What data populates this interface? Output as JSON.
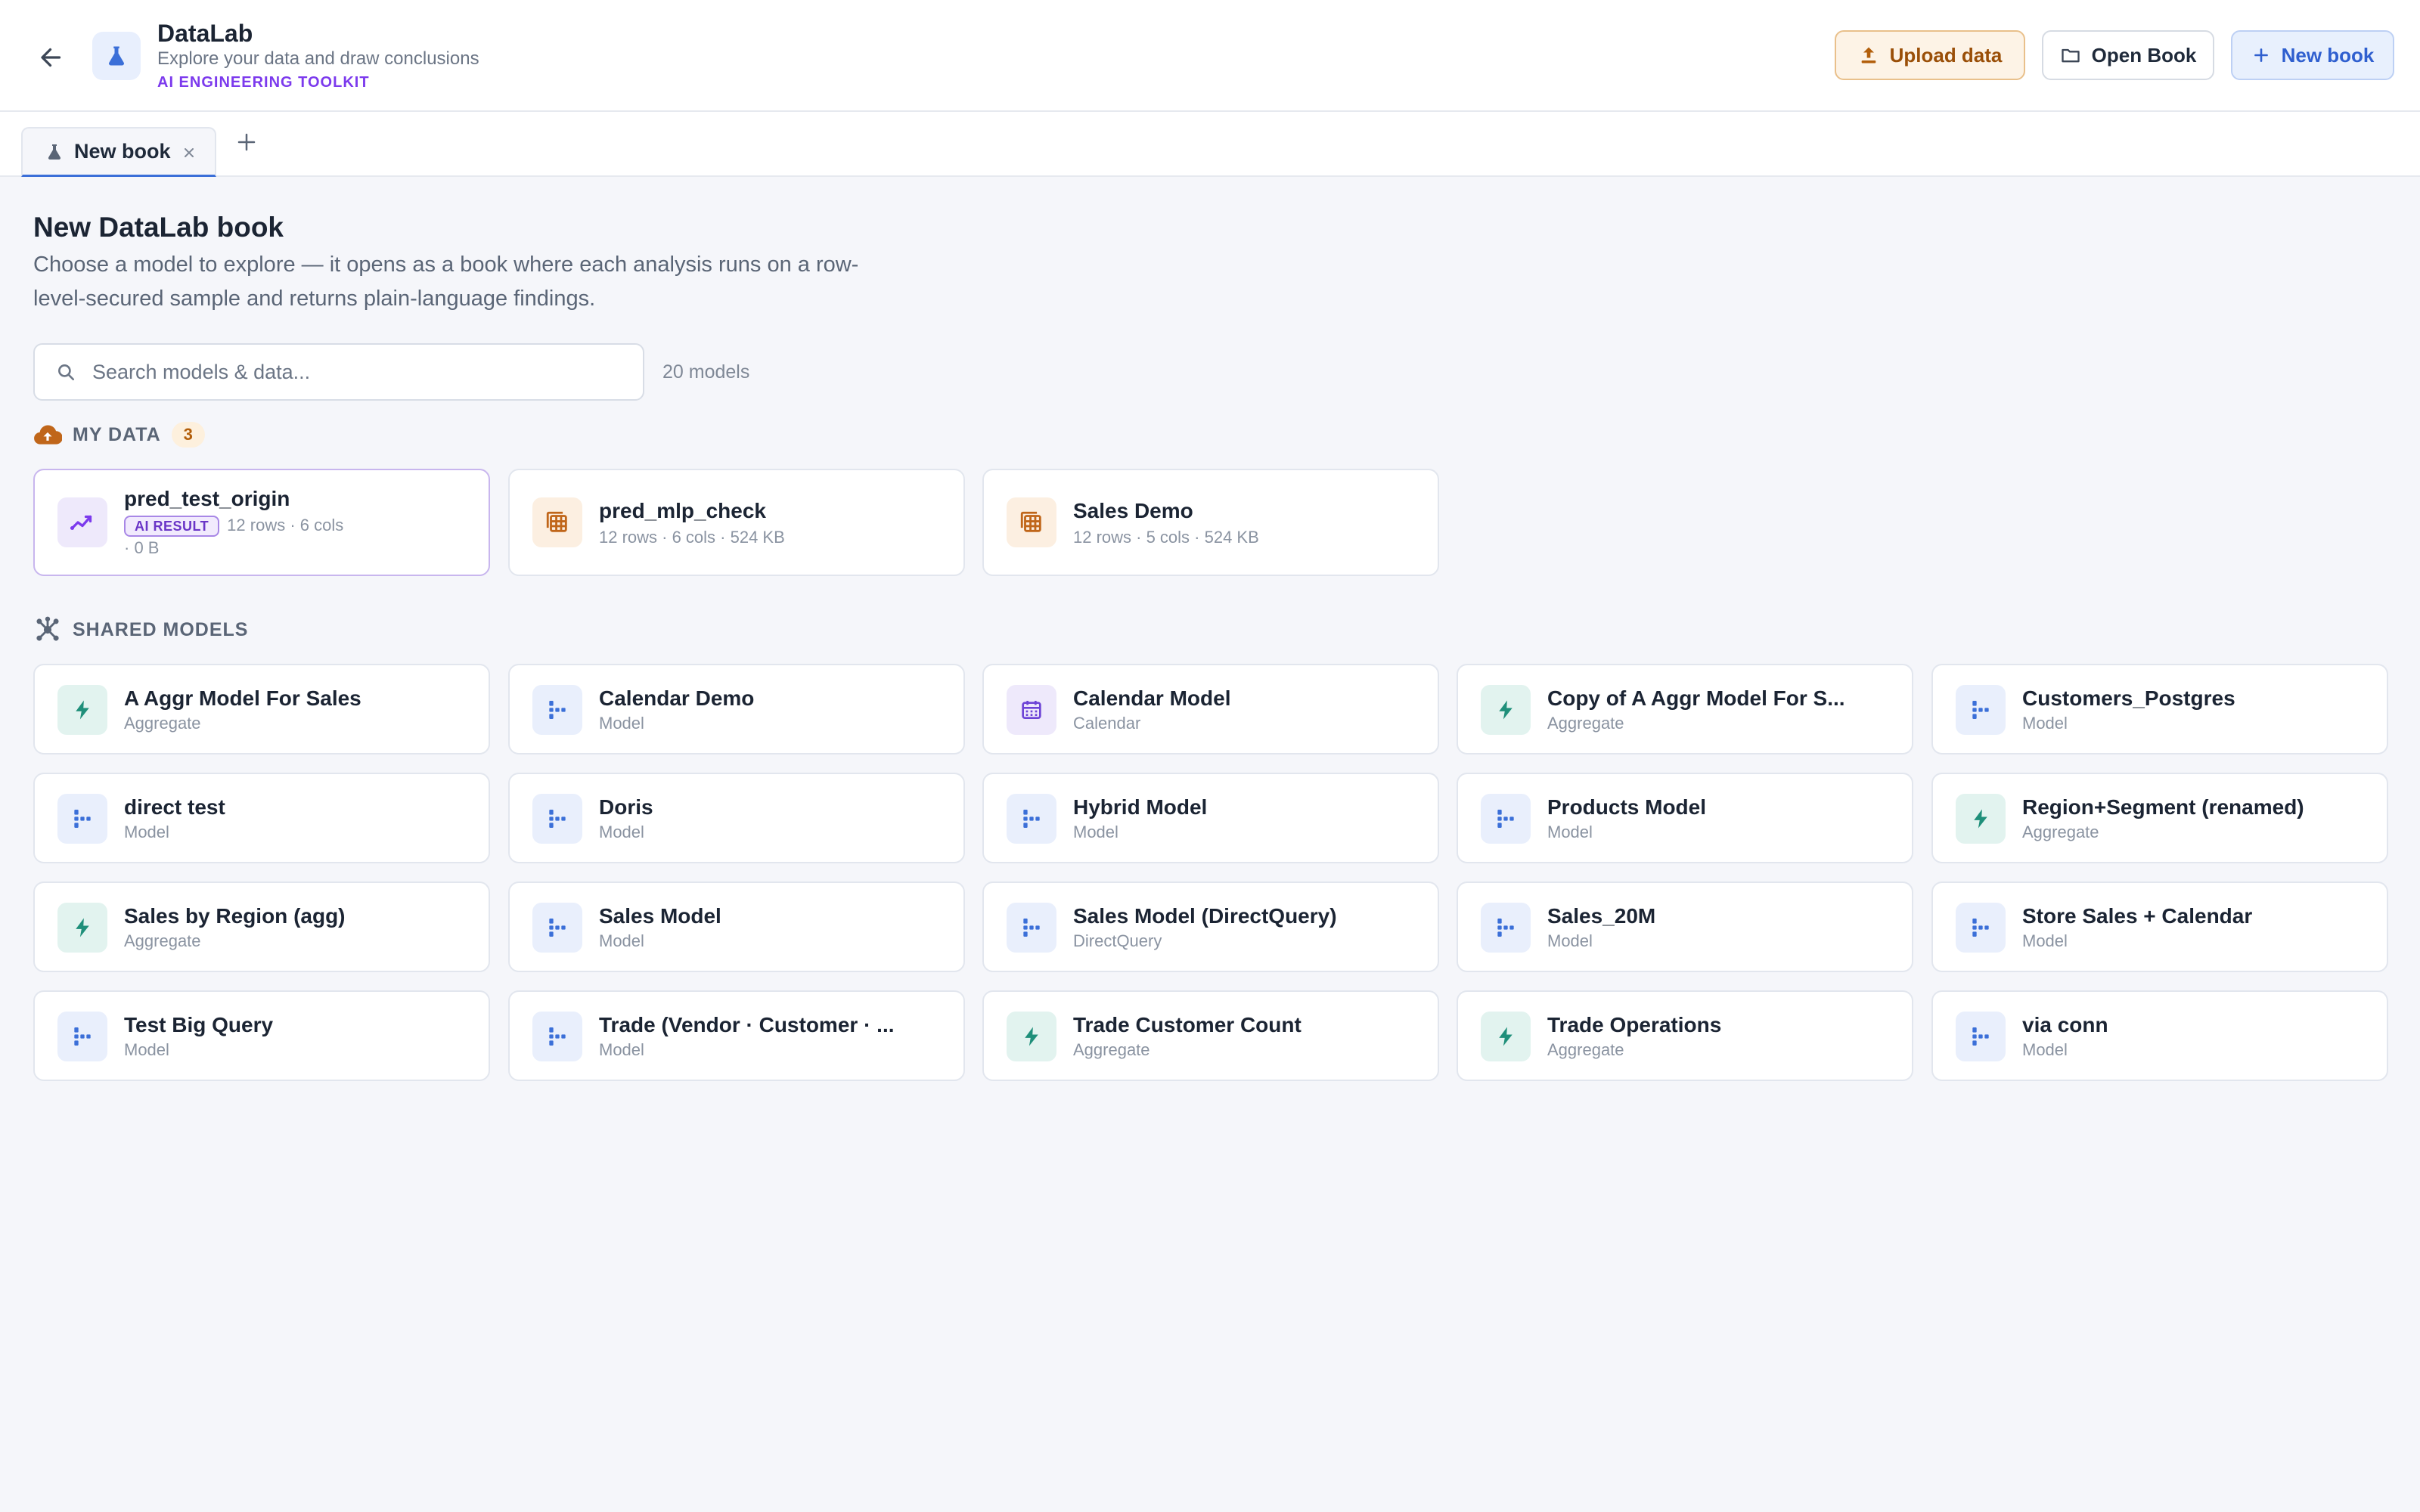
{
  "header": {
    "title": "DataLab",
    "subtitle": "Explore your data and draw conclusions",
    "tag": "AI ENGINEERING TOOLKIT",
    "upload_label": "Upload data",
    "open_label": "Open Book",
    "new_label": "New book"
  },
  "tabs": [
    {
      "label": "New book"
    }
  ],
  "main": {
    "title": "New DataLab book",
    "description": "Choose a model to explore — it opens as a book where each analysis runs on a row-level-secured sample and returns plain-language findings.",
    "search_placeholder": "Search models & data...",
    "model_count": "20 models"
  },
  "my_data": {
    "label": "MY DATA",
    "count": "3",
    "items": [
      {
        "name": "pred_test_origin",
        "badge": "AI RESULT",
        "meta": "12 rows · 6 cols · 0 B",
        "icon": "trend-icon"
      },
      {
        "name": "pred_mlp_check",
        "meta": "12 rows · 6 cols · 524 KB",
        "icon": "table-icon"
      },
      {
        "name": "Sales Demo",
        "meta": "12 rows · 5 cols · 524 KB",
        "icon": "table-icon"
      }
    ]
  },
  "shared": {
    "label": "SHARED MODELS",
    "items": [
      {
        "name": "A Aggr Model For Sales",
        "type": "Aggregate",
        "icon": "bolt"
      },
      {
        "name": "Calendar Demo",
        "type": "Model",
        "icon": "model"
      },
      {
        "name": "Calendar Model",
        "type": "Calendar",
        "icon": "calendar"
      },
      {
        "name": "Copy of A Aggr Model For S...",
        "type": "Aggregate",
        "icon": "bolt"
      },
      {
        "name": "Customers_Postgres",
        "type": "Model",
        "icon": "model"
      },
      {
        "name": "direct test",
        "type": "Model",
        "icon": "model"
      },
      {
        "name": "Doris",
        "type": "Model",
        "icon": "model"
      },
      {
        "name": "Hybrid Model",
        "type": "Model",
        "icon": "model"
      },
      {
        "name": "Products Model",
        "type": "Model",
        "icon": "model"
      },
      {
        "name": "Region+Segment (renamed)",
        "type": "Aggregate",
        "icon": "bolt"
      },
      {
        "name": "Sales by Region (agg)",
        "type": "Aggregate",
        "icon": "bolt"
      },
      {
        "name": "Sales Model",
        "type": "Model",
        "icon": "model"
      },
      {
        "name": "Sales Model (DirectQuery)",
        "type": "DirectQuery",
        "icon": "model"
      },
      {
        "name": "Sales_20M",
        "type": "Model",
        "icon": "model"
      },
      {
        "name": "Store Sales + Calendar",
        "type": "Model",
        "icon": "model"
      },
      {
        "name": "Test Big Query",
        "type": "Model",
        "icon": "model"
      },
      {
        "name": "Trade (Vendor · Customer · ...",
        "type": "Model",
        "icon": "model"
      },
      {
        "name": "Trade Customer Count",
        "type": "Aggregate",
        "icon": "bolt"
      },
      {
        "name": "Trade Operations",
        "type": "Aggregate",
        "icon": "bolt"
      },
      {
        "name": "via conn",
        "type": "Model",
        "icon": "model"
      }
    ]
  },
  "colors": {
    "accent_blue": "#3b6fd8",
    "accent_purple": "#7c3aed",
    "accent_orange": "#b25e0a",
    "accent_green": "#1f8f7a"
  }
}
